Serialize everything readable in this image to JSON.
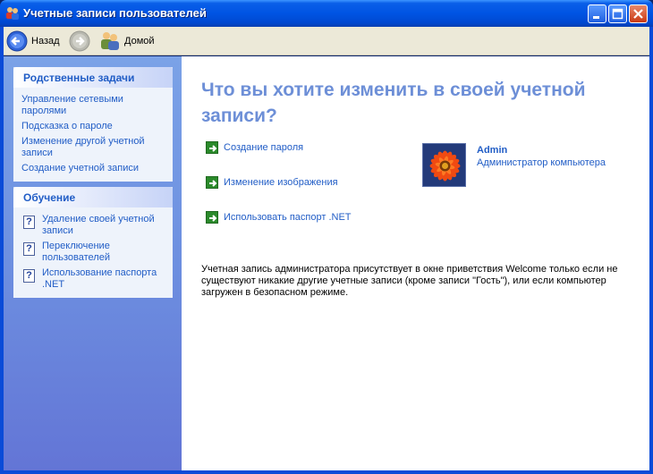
{
  "window": {
    "title": "Учетные записи пользователей"
  },
  "toolbar": {
    "back_label": "Назад",
    "home_label": "Домой"
  },
  "sidebar": {
    "related": {
      "title": "Родственные задачи",
      "items": [
        "Управление сетевыми паролями",
        "Подсказка о пароле",
        "Изменение другой учетной записи",
        "Создание учетной записи"
      ]
    },
    "learn": {
      "title": "Обучение",
      "items": [
        "Удаление своей учетной записи",
        "Переключение пользователей",
        "Использование паспорта .NET"
      ]
    }
  },
  "main": {
    "heading": "Что вы хотите изменить в своей учетной записи?",
    "actions": [
      "Создание пароля",
      "Изменение изображения",
      "Использовать паспорт .NET"
    ],
    "account": {
      "name": "Admin",
      "role": "Администратор компьютера"
    },
    "note": "Учетная запись администратора присутствует в окне приветствия Welcome только если не существуют никакие другие учетные записи (кроме записи \"Гость\"), или если компьютер загружен в безопасном режиме."
  },
  "colors": {
    "titlebar": "#0054e3",
    "link": "#215dc6",
    "heading": "#6d8fd7",
    "taskpane": "#6d8fe0"
  },
  "icons": [
    "users-icon",
    "back-icon",
    "forward-icon",
    "home-users-icon",
    "minimize-icon",
    "maximize-icon",
    "close-icon",
    "help-icon",
    "green-arrow-icon",
    "flower-avatar-icon"
  ]
}
